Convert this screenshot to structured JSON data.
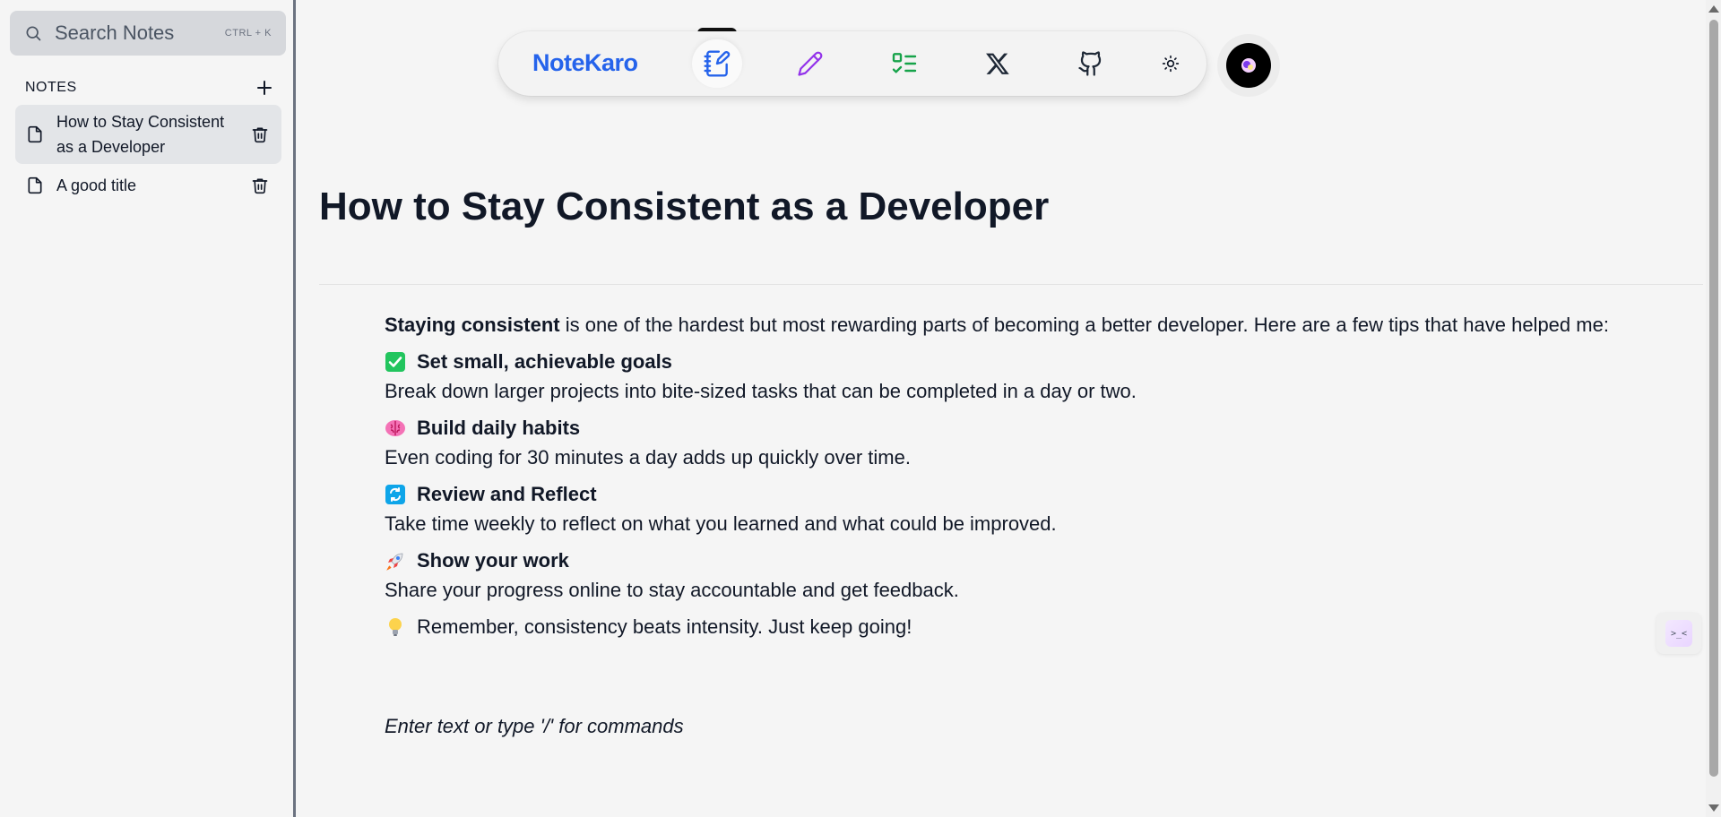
{
  "sidebar": {
    "search": {
      "label": "Search Notes",
      "shortcut": "CTRL + K",
      "icon": "search-icon"
    },
    "notes_header": "NOTES",
    "notes": [
      {
        "title_line1": "How to Stay Consistent",
        "title_line2": "as a Developer",
        "active": true
      },
      {
        "title_line1": "A good title",
        "active": false
      }
    ]
  },
  "nav": {
    "brand": "NoteKaro",
    "items": [
      {
        "icon": "notebook-pen-icon",
        "color": "#2563eb",
        "active": true
      },
      {
        "icon": "pencil-icon",
        "color": "#9333ea"
      },
      {
        "icon": "checklist-icon",
        "color": "#16a34a"
      },
      {
        "icon": "x-logo-icon",
        "color": "#1f2937"
      },
      {
        "icon": "github-icon",
        "color": "#1f2937"
      },
      {
        "icon": "sun-icon",
        "color": "#111827"
      }
    ],
    "avatar": "avatar"
  },
  "note": {
    "title": "How to Stay Consistent as a Developer",
    "intro_bold": "Staying consistent",
    "intro_rest": " is one of the hardest but most rewarding parts of becoming a better developer. Here are a few tips that have helped me:",
    "tips": [
      {
        "emoji": "check-mark-button-icon",
        "heading": "Set small, achievable goals",
        "body": "Break down larger projects into bite-sized tasks that can be completed in a day or two."
      },
      {
        "emoji": "brain-icon",
        "heading": "Build daily habits",
        "body": "Even coding for 30 minutes a day adds up quickly over time."
      },
      {
        "emoji": "cycle-arrows-icon",
        "heading": "Review and Reflect",
        "body": "Take time weekly to reflect on what you learned and what could be improved."
      },
      {
        "emoji": "rocket-icon",
        "heading": "Show your work",
        "body": "Share your progress online to stay accountable and get feedback."
      }
    ],
    "closing": "Remember, consistency beats intensity. Just keep going!",
    "closing_emoji": "light-bulb-icon",
    "editor_placeholder": "Enter text or type '/' for commands"
  },
  "widget": {
    "label": ">_<"
  },
  "colors": {
    "brand": "#2563eb",
    "background": "#f5f5f5",
    "active_note": "#e3e5e8"
  }
}
